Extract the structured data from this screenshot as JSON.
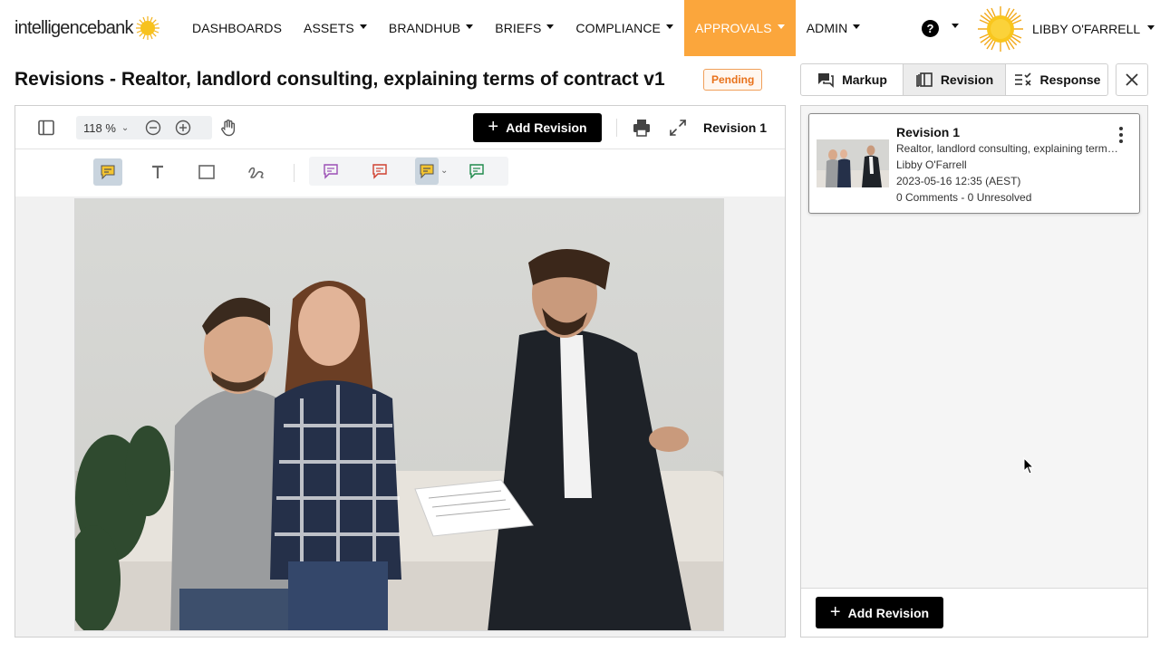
{
  "nav": {
    "brand": "intelligencebank",
    "items": [
      {
        "label": "DASHBOARDS",
        "dropdown": false,
        "active": false
      },
      {
        "label": "ASSETS",
        "dropdown": true,
        "active": false
      },
      {
        "label": "BRANDHUB",
        "dropdown": true,
        "active": false
      },
      {
        "label": "BRIEFS",
        "dropdown": true,
        "active": false
      },
      {
        "label": "COMPLIANCE",
        "dropdown": true,
        "active": false
      },
      {
        "label": "APPROVALS",
        "dropdown": true,
        "active": true
      },
      {
        "label": "ADMIN",
        "dropdown": true,
        "active": false
      }
    ],
    "help_glyph": "?",
    "user_name": "LIBBY O'FARRELL",
    "accent_color": "#fba63c"
  },
  "page": {
    "title": "Revisions - Realtor, landlord consulting, explaining terms of contract v1",
    "status": "Pending"
  },
  "viewer": {
    "zoom": "118 %",
    "add_revision_label": "Add Revision",
    "revision_label": "Revision 1",
    "icons": [
      "sidebar-toggle-icon",
      "zoom-out-icon",
      "zoom-in-icon",
      "pan-hand-icon",
      "print-icon",
      "fullscreen-icon"
    ],
    "annotation_tools": [
      "note-tool",
      "text-tool",
      "rectangle-tool",
      "freehand-tool",
      "comment-purple",
      "comment-red",
      "comment-yellow",
      "comment-green"
    ]
  },
  "panel": {
    "tabs": [
      {
        "label": "Markup",
        "active": false
      },
      {
        "label": "Revision",
        "active": true
      },
      {
        "label": "Response",
        "active": false
      }
    ],
    "revisions": [
      {
        "title": "Revision 1",
        "description": "Realtor, landlord consulting, explaining terms of contract",
        "author": "Libby O'Farrell",
        "date": "2023-05-16 12:35 (AEST)",
        "stats": "0 Comments - 0 Unresolved"
      }
    ],
    "add_revision_label": "Add Revision"
  }
}
